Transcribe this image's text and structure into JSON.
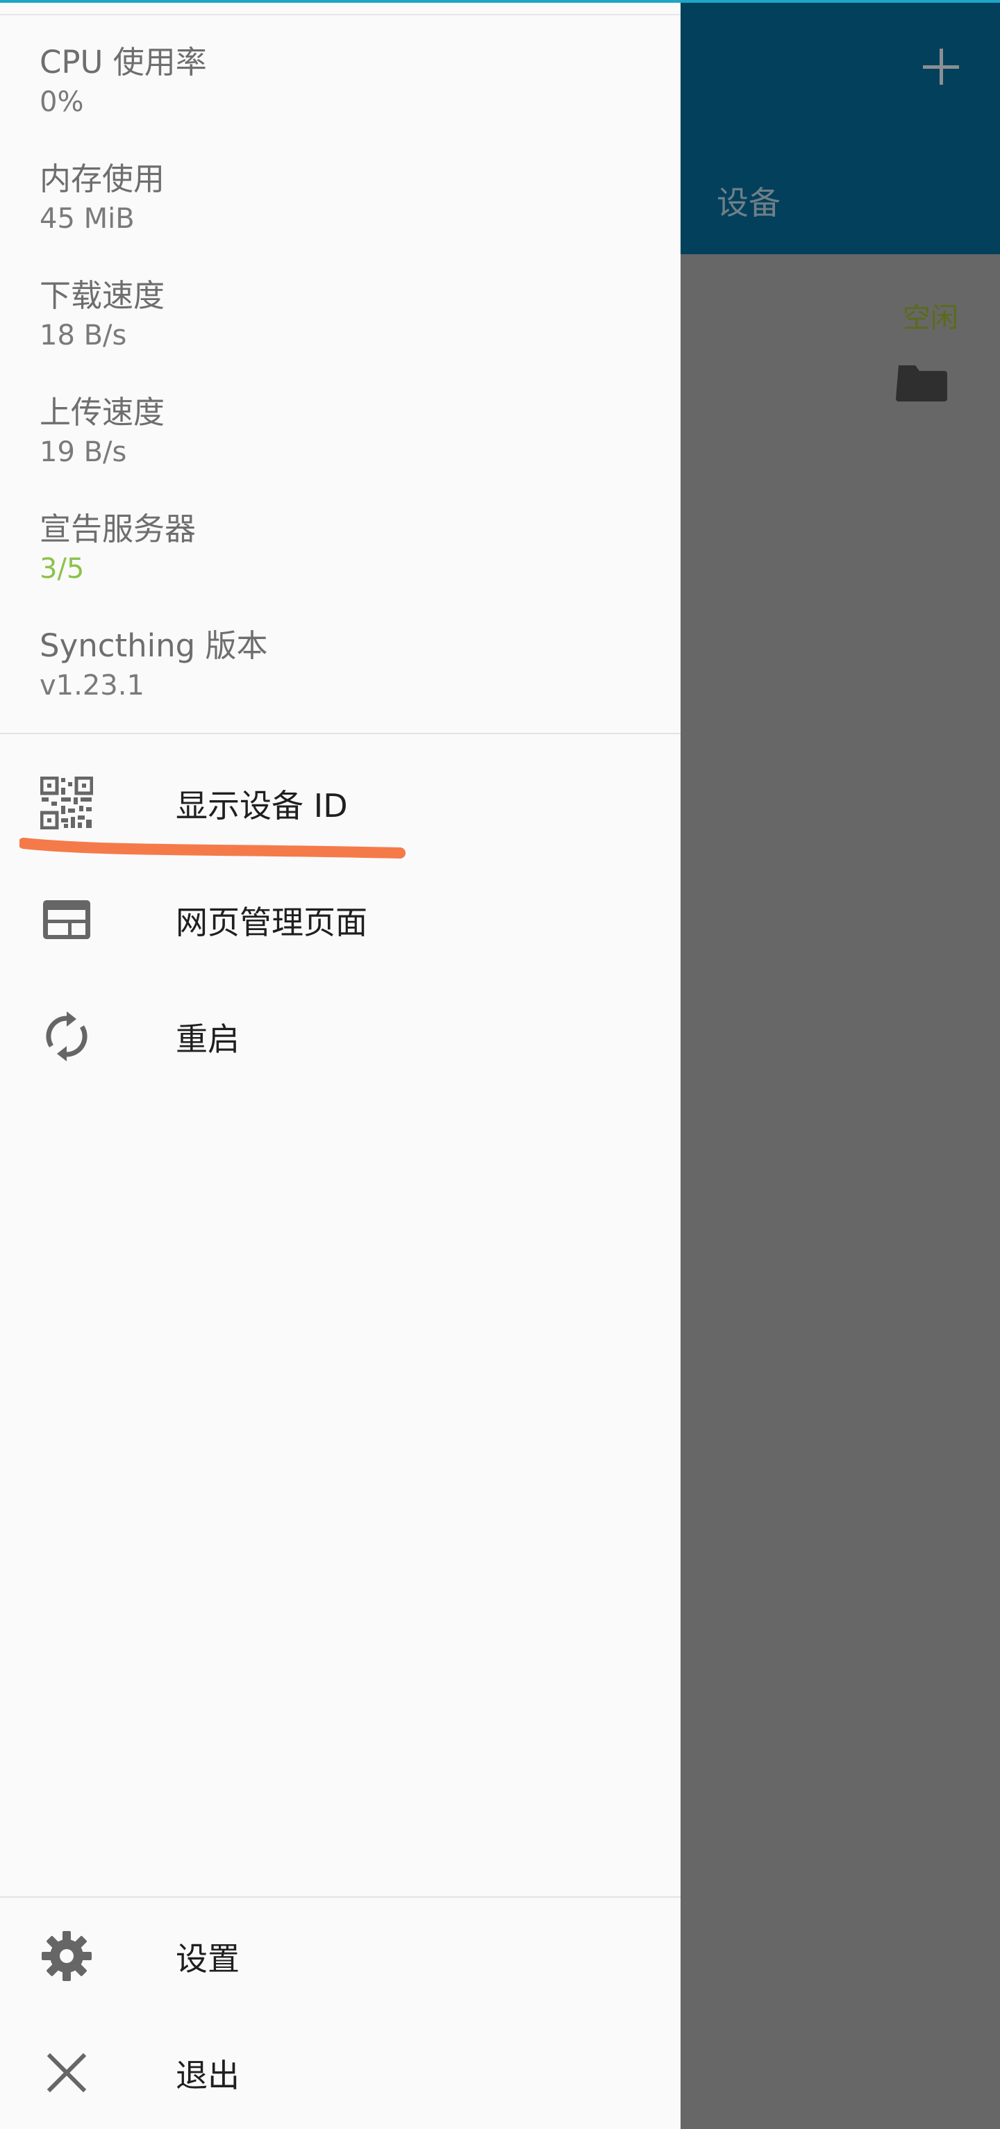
{
  "background_app": {
    "add_icon": "plus-icon",
    "tab_label": "设备",
    "folder_status": "空闲",
    "folder_icon": "folder-icon",
    "appbar_color": "#03405c"
  },
  "drawer": {
    "stats": [
      {
        "label": "CPU 使用率",
        "value": "0%"
      },
      {
        "label": "内存使用",
        "value": "45 MiB"
      },
      {
        "label": "下载速度",
        "value": "18 B/s"
      },
      {
        "label": "上传速度",
        "value": "19 B/s"
      },
      {
        "label": "宣告服务器",
        "value": "3/5",
        "value_color": "#8bc34a"
      },
      {
        "label": "Syncthing 版本",
        "value": "v1.23.1"
      }
    ],
    "menu": [
      {
        "label": "显示设备 ID",
        "icon": "qr-code-icon"
      },
      {
        "label": "网页管理页面",
        "icon": "web-window-icon"
      },
      {
        "label": "重启",
        "icon": "restart-icon"
      }
    ],
    "bottom_menu": [
      {
        "label": "设置",
        "icon": "gear-icon"
      },
      {
        "label": "退出",
        "icon": "close-icon"
      }
    ]
  },
  "annotation": {
    "color": "#f57a4a",
    "target": "显示设备 ID"
  }
}
